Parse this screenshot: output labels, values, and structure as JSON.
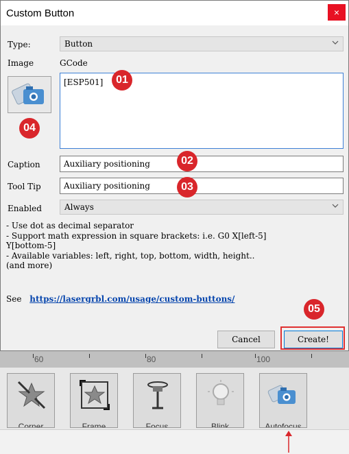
{
  "window": {
    "title": "Custom Button",
    "close_glyph": "×"
  },
  "form": {
    "type_label": "Type:",
    "type_value": "Button",
    "image_label": "Image",
    "gcode_label": "GCode",
    "gcode_value": "[ESP501]",
    "caption_label": "Caption",
    "caption_value": "Auxiliary positioning",
    "tooltip_label": "Tool Tip",
    "tooltip_value": "Auxiliary positioning",
    "enabled_label": "Enabled",
    "enabled_value": "Always"
  },
  "notes": [
    "- Use dot as decimal separator",
    "- Support math expression in square brackets: i.e. G0 X[left-5]",
    "Y[bottom-5]",
    "- Available variables: left, right, top, bottom, width, height..",
    "(and more)"
  ],
  "see": {
    "label": "See",
    "link": "https://lasergrbl.com/usage/custom-buttons/"
  },
  "buttons": {
    "cancel": "Cancel",
    "create": "Create!"
  },
  "annotations": [
    "01",
    "02",
    "03",
    "04",
    "05"
  ],
  "ruler": {
    "ticks": [
      "60",
      "80",
      "100"
    ]
  },
  "toolbar": {
    "items": [
      {
        "label": "Corner",
        "icon": "corner-icon"
      },
      {
        "label": "Frame",
        "icon": "frame-icon"
      },
      {
        "label": "Focus",
        "icon": "focus-icon"
      },
      {
        "label": "Blink",
        "icon": "blink-icon"
      },
      {
        "label": "Autofocus",
        "icon": "autofocus-icon"
      }
    ]
  },
  "colors": {
    "accent_red": "#d9262b",
    "link_blue": "#0645ad",
    "close_red": "#e81123"
  }
}
